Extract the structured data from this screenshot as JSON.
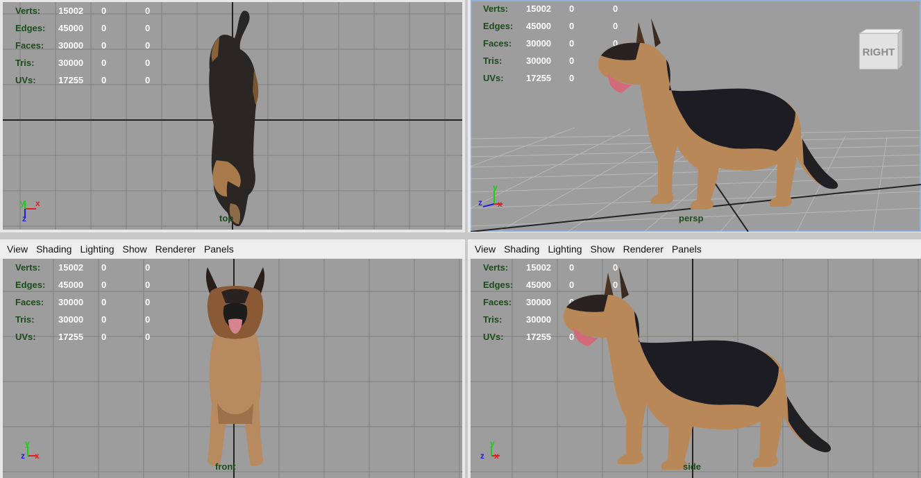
{
  "menu": [
    "View",
    "Shading",
    "Lighting",
    "Show",
    "Renderer",
    "Panels"
  ],
  "hud": {
    "labels": [
      "Verts:",
      "Edges:",
      "Faces:",
      "Tris:",
      "UVs:"
    ],
    "rows": [
      [
        "15002",
        "0",
        "0"
      ],
      [
        "45000",
        "0",
        "0"
      ],
      [
        "30000",
        "0",
        "0"
      ],
      [
        "30000",
        "0",
        "0"
      ],
      [
        "17255",
        "0",
        "0"
      ]
    ]
  },
  "viewports": {
    "top": {
      "camera": "top"
    },
    "persp": {
      "camera": "persp",
      "viewcube": "RIGHT"
    },
    "front": {
      "camera": "front"
    },
    "side": {
      "camera": "side"
    }
  },
  "axes": {
    "x": "x",
    "y": "y",
    "z": "z"
  },
  "colors": {
    "viewport_bg": "#9d9d9d",
    "grid": "#7e7e7e",
    "axis_x": "#e01e1e",
    "axis_y": "#1ec81e",
    "axis_z": "#1e1ee0",
    "hud_label": "#1c4b1c",
    "dog_dark": "#1e1e22",
    "dog_tan": "#b8885a"
  }
}
